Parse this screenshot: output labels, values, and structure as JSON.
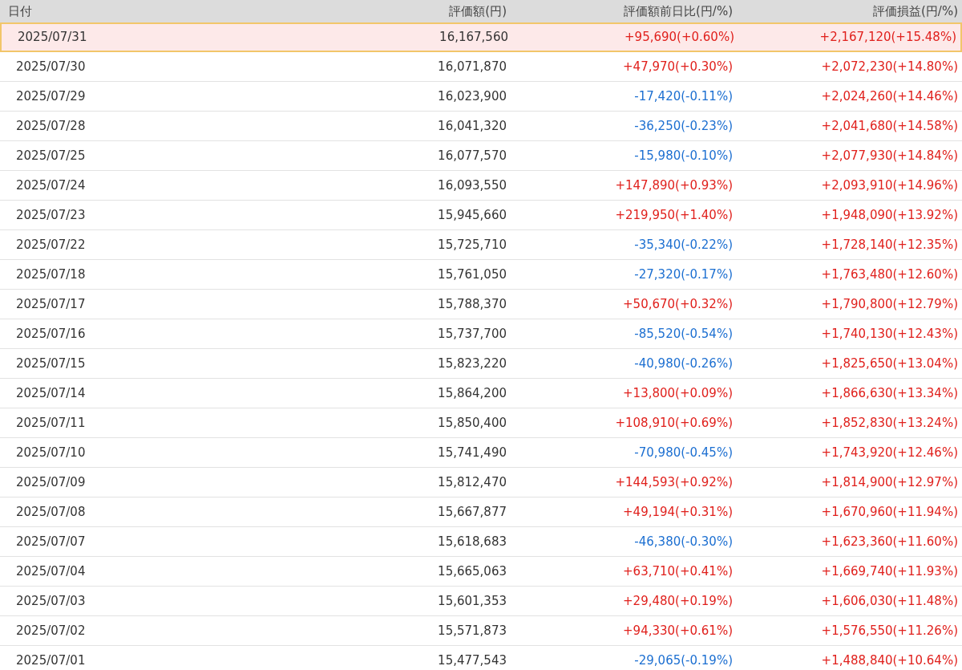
{
  "table": {
    "columns": [
      "日付",
      "評価額(円)",
      "評価額前日比(円/%)",
      "評価損益(円/%)"
    ],
    "rows": [
      {
        "selected": true,
        "date": "2025/07/31",
        "value": "16,167,560",
        "change": "+95,690(+0.60%)",
        "change_up": true,
        "pnl": "+2,167,120(+15.48%)",
        "pnl_up": true
      },
      {
        "selected": false,
        "date": "2025/07/30",
        "value": "16,071,870",
        "change": "+47,970(+0.30%)",
        "change_up": true,
        "pnl": "+2,072,230(+14.80%)",
        "pnl_up": true
      },
      {
        "selected": false,
        "date": "2025/07/29",
        "value": "16,023,900",
        "change": "-17,420(-0.11%)",
        "change_up": false,
        "pnl": "+2,024,260(+14.46%)",
        "pnl_up": true
      },
      {
        "selected": false,
        "date": "2025/07/28",
        "value": "16,041,320",
        "change": "-36,250(-0.23%)",
        "change_up": false,
        "pnl": "+2,041,680(+14.58%)",
        "pnl_up": true
      },
      {
        "selected": false,
        "date": "2025/07/25",
        "value": "16,077,570",
        "change": "-15,980(-0.10%)",
        "change_up": false,
        "pnl": "+2,077,930(+14.84%)",
        "pnl_up": true
      },
      {
        "selected": false,
        "date": "2025/07/24",
        "value": "16,093,550",
        "change": "+147,890(+0.93%)",
        "change_up": true,
        "pnl": "+2,093,910(+14.96%)",
        "pnl_up": true
      },
      {
        "selected": false,
        "date": "2025/07/23",
        "value": "15,945,660",
        "change": "+219,950(+1.40%)",
        "change_up": true,
        "pnl": "+1,948,090(+13.92%)",
        "pnl_up": true
      },
      {
        "selected": false,
        "date": "2025/07/22",
        "value": "15,725,710",
        "change": "-35,340(-0.22%)",
        "change_up": false,
        "pnl": "+1,728,140(+12.35%)",
        "pnl_up": true
      },
      {
        "selected": false,
        "date": "2025/07/18",
        "value": "15,761,050",
        "change": "-27,320(-0.17%)",
        "change_up": false,
        "pnl": "+1,763,480(+12.60%)",
        "pnl_up": true
      },
      {
        "selected": false,
        "date": "2025/07/17",
        "value": "15,788,370",
        "change": "+50,670(+0.32%)",
        "change_up": true,
        "pnl": "+1,790,800(+12.79%)",
        "pnl_up": true
      },
      {
        "selected": false,
        "date": "2025/07/16",
        "value": "15,737,700",
        "change": "-85,520(-0.54%)",
        "change_up": false,
        "pnl": "+1,740,130(+12.43%)",
        "pnl_up": true
      },
      {
        "selected": false,
        "date": "2025/07/15",
        "value": "15,823,220",
        "change": "-40,980(-0.26%)",
        "change_up": false,
        "pnl": "+1,825,650(+13.04%)",
        "pnl_up": true
      },
      {
        "selected": false,
        "date": "2025/07/14",
        "value": "15,864,200",
        "change": "+13,800(+0.09%)",
        "change_up": true,
        "pnl": "+1,866,630(+13.34%)",
        "pnl_up": true
      },
      {
        "selected": false,
        "date": "2025/07/11",
        "value": "15,850,400",
        "change": "+108,910(+0.69%)",
        "change_up": true,
        "pnl": "+1,852,830(+13.24%)",
        "pnl_up": true
      },
      {
        "selected": false,
        "date": "2025/07/10",
        "value": "15,741,490",
        "change": "-70,980(-0.45%)",
        "change_up": false,
        "pnl": "+1,743,920(+12.46%)",
        "pnl_up": true
      },
      {
        "selected": false,
        "date": "2025/07/09",
        "value": "15,812,470",
        "change": "+144,593(+0.92%)",
        "change_up": true,
        "pnl": "+1,814,900(+12.97%)",
        "pnl_up": true
      },
      {
        "selected": false,
        "date": "2025/07/08",
        "value": "15,667,877",
        "change": "+49,194(+0.31%)",
        "change_up": true,
        "pnl": "+1,670,960(+11.94%)",
        "pnl_up": true
      },
      {
        "selected": false,
        "date": "2025/07/07",
        "value": "15,618,683",
        "change": "-46,380(-0.30%)",
        "change_up": false,
        "pnl": "+1,623,360(+11.60%)",
        "pnl_up": true
      },
      {
        "selected": false,
        "date": "2025/07/04",
        "value": "15,665,063",
        "change": "+63,710(+0.41%)",
        "change_up": true,
        "pnl": "+1,669,740(+11.93%)",
        "pnl_up": true
      },
      {
        "selected": false,
        "date": "2025/07/03",
        "value": "15,601,353",
        "change": "+29,480(+0.19%)",
        "change_up": true,
        "pnl": "+1,606,030(+11.48%)",
        "pnl_up": true
      },
      {
        "selected": false,
        "date": "2025/07/02",
        "value": "15,571,873",
        "change": "+94,330(+0.61%)",
        "change_up": true,
        "pnl": "+1,576,550(+11.26%)",
        "pnl_up": true
      },
      {
        "selected": false,
        "date": "2025/07/01",
        "value": "15,477,543",
        "change": "-29,065(-0.19%)",
        "change_up": false,
        "pnl": "+1,488,840(+10.64%)",
        "pnl_up": true
      }
    ]
  }
}
